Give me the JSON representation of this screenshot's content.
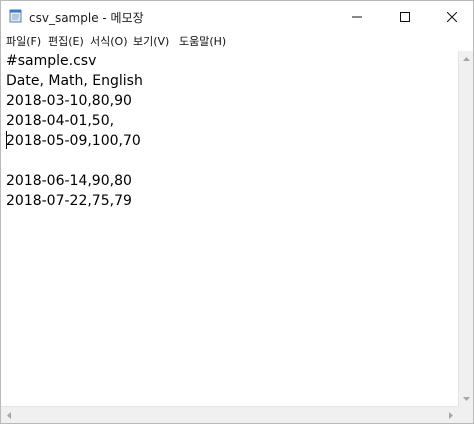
{
  "window": {
    "title": "csv_sample - 메모장",
    "icons": {
      "app": "notepad-icon",
      "minimize": "minimize-icon",
      "maximize": "maximize-icon",
      "close": "close-icon"
    }
  },
  "menu": {
    "items": [
      {
        "label": "파일(F)"
      },
      {
        "label": "편집(E)"
      },
      {
        "label": "서식(O)"
      },
      {
        "label": "보기(V)"
      },
      {
        "label": "도움말(H)"
      }
    ]
  },
  "editor": {
    "lines": [
      "#sample.csv",
      "Date, Math, English",
      "2018-03-10,80,90",
      "2018-04-01,50,",
      "2018-05-09,100,70",
      "",
      "2018-06-14,90,80",
      "2018-07-22,75,79"
    ]
  }
}
